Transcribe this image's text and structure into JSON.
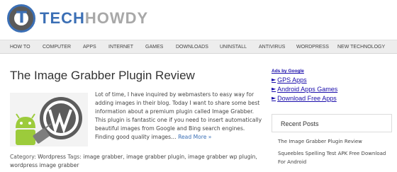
{
  "site": {
    "logo_tech": "TECH",
    "logo_howdy": "HOWDY"
  },
  "nav": [
    {
      "label": "HOW TO"
    },
    {
      "label": "COMPUTER"
    },
    {
      "label": "APPS"
    },
    {
      "label": "INTERNET"
    },
    {
      "label": "GAMES"
    },
    {
      "label": "DOWNLOADS"
    },
    {
      "label": "UNINSTALL"
    },
    {
      "label": "ANTIVIRUS"
    },
    {
      "label": "WORDPRESS"
    },
    {
      "label": "NEW TECHNOLOGY"
    }
  ],
  "article": {
    "title": "The Image Grabber Plugin Review",
    "excerpt": "Lot of time, I have inquired by webmasters to easy way for adding images in their blog. Today I want to share some best information about a premium plugin called Image Grabber. This plugin is fantastic one if you need to insert automatically beautiful images from Google and Bing search engines. Finding good quality images… ",
    "read_more": "Read More »",
    "category_label": "Category: ",
    "category": "Wordpress",
    "tags_label": " Tags: ",
    "tags": [
      "image grabber",
      "image grabber plugin",
      "image grabber wp plugin",
      "wordpress image grabber"
    ]
  },
  "sidebar": {
    "ads_by": "Ads by Google",
    "ads": [
      {
        "label": "GPS Apps"
      },
      {
        "label": "Android Apps Games"
      },
      {
        "label": "Download Free Apps"
      }
    ],
    "recent_title": "Recent Posts",
    "recent_posts": [
      {
        "label": "The Image Grabber Plugin Review"
      },
      {
        "label": "Squeebles Spelling Test APK Free Download For Android"
      }
    ]
  },
  "colors": {
    "brand_blue": "#3b6fb5",
    "ad_link": "#1a0dab",
    "nav_bg": "#ededed"
  }
}
